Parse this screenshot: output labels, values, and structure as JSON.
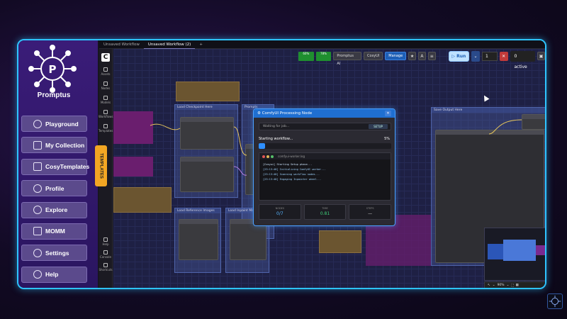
{
  "sidebar": {
    "brand": "Promptus",
    "items": [
      {
        "label": "Playground",
        "icon": "play-circle-icon"
      },
      {
        "label": "My Collection",
        "icon": "grid-icon"
      },
      {
        "label": "CosyTemplates",
        "icon": "template-icon"
      },
      {
        "label": "Profile",
        "icon": "user-icon"
      },
      {
        "label": "Explore",
        "icon": "search-icon"
      },
      {
        "label": "MOMM",
        "icon": "momm-icon"
      },
      {
        "label": "Settings",
        "icon": "gear-icon"
      },
      {
        "label": "Help",
        "icon": "help-icon"
      }
    ],
    "templates_tab": "TEMPLATES"
  },
  "tabs": {
    "items": [
      {
        "label": "Unsaved Workflow"
      },
      {
        "label": "Unsaved Workflow (2)"
      }
    ],
    "add": "+"
  },
  "rail": {
    "items": [
      "Assets",
      "Nodes",
      "Models",
      "Workflows",
      "Templates"
    ],
    "bottom": [
      "Help",
      "Console",
      "Shortcuts"
    ]
  },
  "toolbar": {
    "stat1": "60%",
    "stat2": "78%",
    "promptus_ai": "Promptus AI",
    "cosyui": "CosyUI",
    "manage": "Manage",
    "run": "Run",
    "queue_count": "1",
    "active": "0 active"
  },
  "modal": {
    "title": "ComfyUI Processing Node",
    "status": "Waiting for job...",
    "setup": "SETUP",
    "phase": "Starting workflow...",
    "percent": "5%",
    "progress": 0.05,
    "log_title": "comfyui-worker.log",
    "log": [
      "[Cosyui] Starting Setup phase...",
      "[23:13:48] Initializing ComfyUI worker...",
      "[23:13:48] Scanning workflow nodes...",
      "[23:13:48] Engaging Inpainter wheel..."
    ],
    "metrics": [
      {
        "label": "NODES",
        "value": "0/7"
      },
      {
        "label": "TIME",
        "value": "0.81"
      },
      {
        "label": "STEPS",
        "value": "—"
      }
    ]
  },
  "canvas": {
    "groups": [
      "Load Checkpoint Here",
      "Prompts",
      "Load Reference Images",
      "Load Inpaint Mask",
      "Save Output Here"
    ]
  },
  "minimap": {
    "zoom": "90%"
  },
  "colors": {
    "accent": "#2ec4ff",
    "sidebar": "#3a1c78",
    "templates": "#f2a623",
    "run": "#bfe2ff",
    "stop": "#c23a3a"
  }
}
